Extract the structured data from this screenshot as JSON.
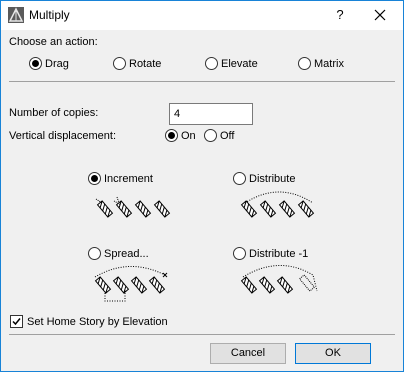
{
  "window": {
    "title": "Multiply",
    "help_label": "?",
    "icons": {
      "app": "archicad-app-icon",
      "close": "close-icon"
    }
  },
  "action": {
    "heading": "Choose an action:",
    "options": [
      {
        "label": "Drag",
        "selected": true
      },
      {
        "label": "Rotate",
        "selected": false
      },
      {
        "label": "Elevate",
        "selected": false
      },
      {
        "label": "Matrix",
        "selected": false
      }
    ]
  },
  "copies": {
    "label": "Number of copies:",
    "value": "4"
  },
  "vertical_displacement": {
    "label": "Vertical displacement:",
    "options": [
      {
        "label": "On",
        "selected": true
      },
      {
        "label": "Off",
        "selected": false
      }
    ]
  },
  "modes": [
    {
      "label": "Increment",
      "selected": true,
      "icon": "increment-diagram-icon"
    },
    {
      "label": "Distribute",
      "selected": false,
      "icon": "distribute-diagram-icon"
    },
    {
      "label": "Spread...",
      "selected": false,
      "icon": "spread-diagram-icon"
    },
    {
      "label": "Distribute -1",
      "selected": false,
      "icon": "distribute-minus-one-diagram-icon"
    }
  ],
  "home_story": {
    "label": "Set Home Story by Elevation",
    "checked": true
  },
  "buttons": {
    "cancel": "Cancel",
    "ok": "OK"
  }
}
